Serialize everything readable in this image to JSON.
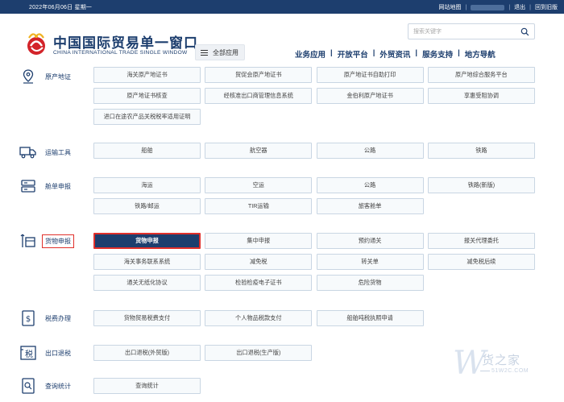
{
  "topbar": {
    "date": "2022年06月06日 星期一",
    "sitemap": "网站地图",
    "logout": "退出",
    "old_version": "回到旧版"
  },
  "header": {
    "title": "中国国际贸易单一窗口",
    "subtitle": "CHINA INTERNATIONAL TRADE SINGLE WINDOW",
    "all_apps": "全部应用",
    "search_placeholder": "搜索关键字",
    "nav": [
      "业务应用",
      "开放平台",
      "外贸资讯",
      "服务支持",
      "地方导航"
    ]
  },
  "categories": [
    {
      "label": "原产地证",
      "icon": "location-pin-icon",
      "items": [
        "海关原产地证书",
        "贸促会原产地证书",
        "原产地证书自助打印",
        "原产地综合服务平台",
        "原产地证书核查",
        "经核准出口商管理信息系统",
        "金伯利原产地证书",
        "享惠受阻协调",
        "进口在途农产品关税税率适用证明"
      ]
    },
    {
      "label": "运输工具",
      "icon": "truck-icon",
      "items": [
        "船舶",
        "航空器",
        "公路",
        "铁路"
      ]
    },
    {
      "label": "舱单申报",
      "icon": "manifest-icon",
      "items": [
        "海运",
        "空运",
        "公路",
        "铁路(新版)",
        "铁路/邮运",
        "TIR运输",
        "旅客舱单"
      ]
    },
    {
      "label": "货物申报",
      "icon": "goods-declaration-icon",
      "items": [
        "货物申报",
        "集中申报",
        "预约通关",
        "报关代理委托",
        "海关事务联系系统",
        "减免税",
        "转关单",
        "减免税后续",
        "通关无纸化协议",
        "检验检疫电子证书",
        "危险货物"
      ]
    },
    {
      "label": "税费办理",
      "icon": "tax-icon",
      "items": [
        "货物贸易税费支付",
        "个人物品税款支付",
        "船舶吨税执照申请"
      ]
    },
    {
      "label": "出口退税",
      "icon": "tax-refund-icon",
      "items": [
        "出口退税(外贸版)",
        "出口退税(生产版)"
      ]
    },
    {
      "label": "查询统计",
      "icon": "query-icon",
      "items": [
        "查询统计"
      ]
    }
  ],
  "watermark": {
    "brand": "货之家",
    "url": "51W2C.COM"
  },
  "colors": {
    "primary": "#1d3e6e",
    "highlight": "#e0302b",
    "button_bg": "#f7fafc",
    "button_border": "#c9d6e3"
  }
}
